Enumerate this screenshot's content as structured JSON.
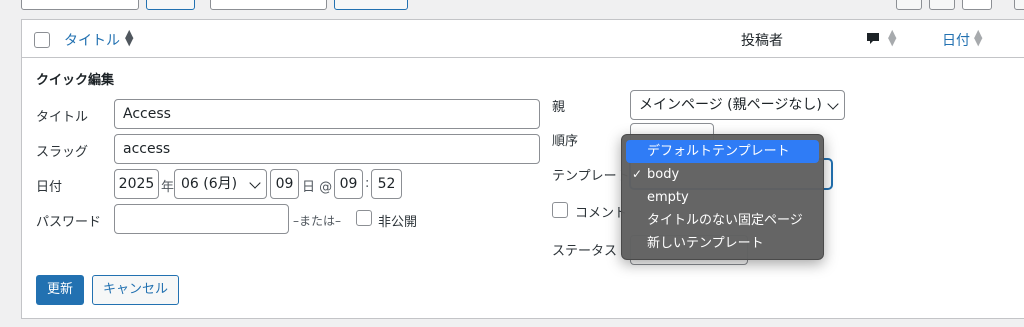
{
  "table_header": {
    "title": "タイトル",
    "author": "投稿者",
    "date": "日付"
  },
  "quick_edit": {
    "heading": "クイック編集",
    "title_label": "タイトル",
    "title_value": "Access",
    "slug_label": "スラッグ",
    "slug_value": "access",
    "date_label": "日付",
    "year": "2025",
    "year_suffix": "年",
    "month": "06 (6月)",
    "day": "09",
    "day_suffix": "日 @",
    "hour": "09",
    "colon": ":",
    "minute": "52",
    "password_label": "パスワード",
    "or_text": "–または–",
    "private_label": "非公開",
    "parent_label": "親",
    "parent_value": "メインページ (親ページなし)",
    "order_label": "順序",
    "template_label": "テンプレート",
    "comment_label": "コメント",
    "status_label": "ステータス"
  },
  "buttons": {
    "update": "更新",
    "cancel": "キャンセル"
  },
  "template_menu": {
    "items": [
      {
        "label": "デフォルトテンプレート",
        "highlighted": true,
        "checked": false
      },
      {
        "label": "body",
        "highlighted": false,
        "checked": true
      },
      {
        "label": "empty",
        "highlighted": false,
        "checked": false
      },
      {
        "label": "タイトルのない固定ページ",
        "highlighted": false,
        "checked": false
      },
      {
        "label": "新しいテンプレート",
        "highlighted": false,
        "checked": false
      }
    ],
    "check_mark": "✓"
  },
  "colors": {
    "accent": "#2271b1",
    "menu_highlight": "#2f7cf6"
  }
}
